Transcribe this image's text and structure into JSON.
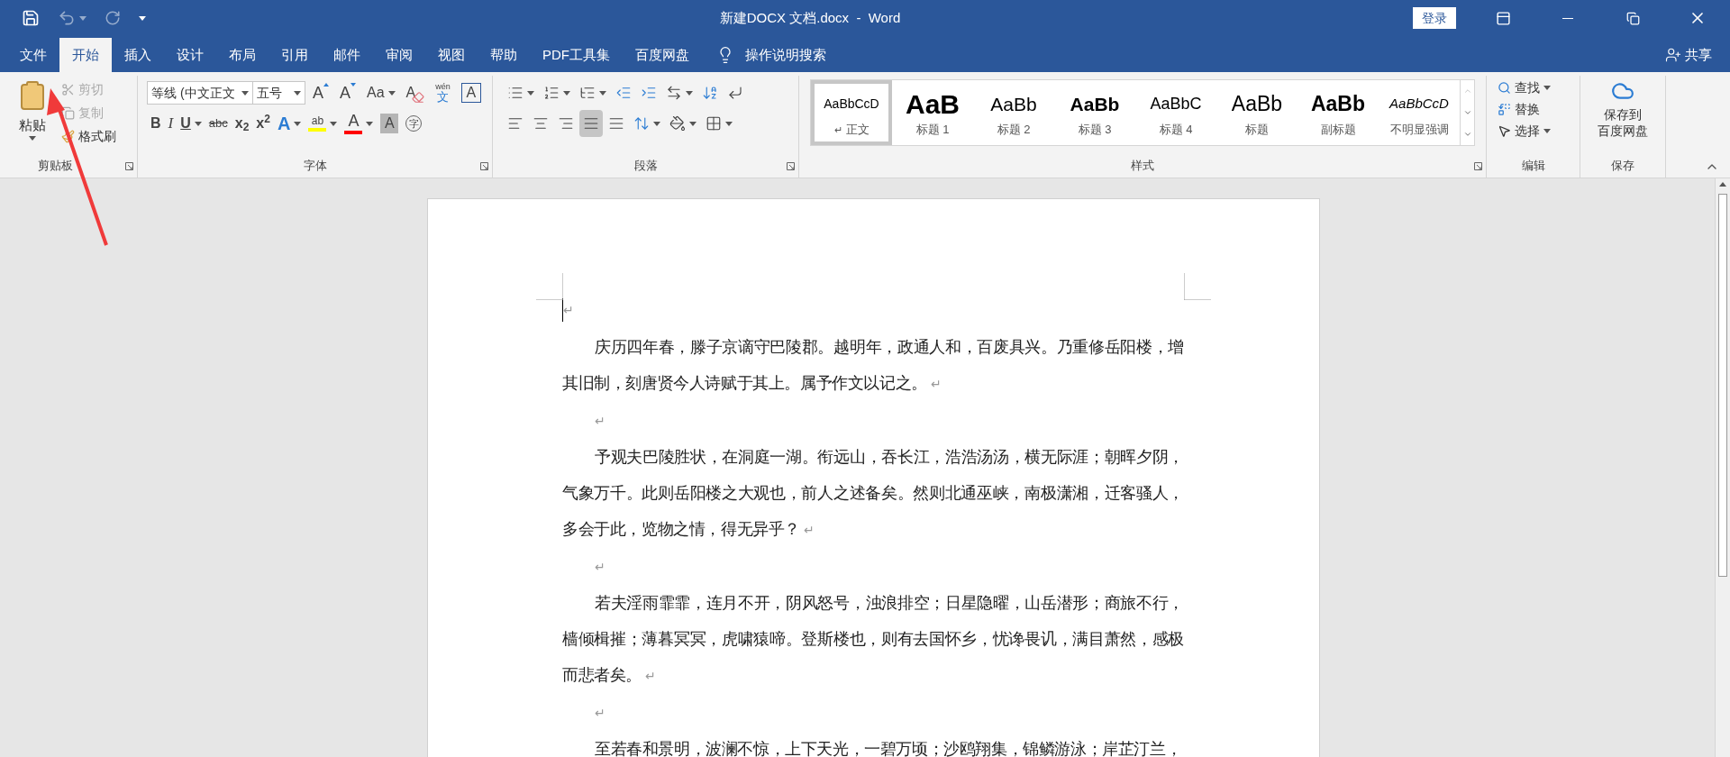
{
  "title_bar": {
    "title": "新建DOCX 文档.docx  -  Word",
    "login": "登录"
  },
  "tabs": [
    {
      "label": "文件",
      "selected": false
    },
    {
      "label": "开始",
      "selected": true
    },
    {
      "label": "插入",
      "selected": false
    },
    {
      "label": "设计",
      "selected": false
    },
    {
      "label": "布局",
      "selected": false
    },
    {
      "label": "引用",
      "selected": false
    },
    {
      "label": "邮件",
      "selected": false
    },
    {
      "label": "审阅",
      "selected": false
    },
    {
      "label": "视图",
      "selected": false
    },
    {
      "label": "帮助",
      "selected": false
    },
    {
      "label": "PDF工具集",
      "selected": false
    },
    {
      "label": "百度网盘",
      "selected": false
    }
  ],
  "tell_me": "操作说明搜索",
  "share": "共享",
  "clipboard": {
    "group": "剪贴板",
    "launcher": true,
    "paste": "粘贴",
    "cut": {
      "label": "剪切",
      "disabled": true
    },
    "copy": {
      "label": "复制",
      "disabled": true
    },
    "painter": {
      "label": "格式刷",
      "disabled": false
    }
  },
  "font": {
    "group": "字体",
    "launcher": true,
    "name": "等线 (中文正文",
    "size": "五号",
    "row1": [
      {
        "kind": "grow",
        "label": "A"
      },
      {
        "kind": "shrink",
        "label": "A"
      },
      {
        "kind": "case",
        "label": "Aa",
        "dropdown": true
      },
      {
        "kind": "clear",
        "label": "A"
      },
      {
        "kind": "phonetic",
        "label": "wén",
        "sub": "文"
      },
      {
        "kind": "border",
        "label": "A"
      }
    ],
    "row2": [
      {
        "kind": "bold",
        "label": "B"
      },
      {
        "kind": "italic",
        "label": "I"
      },
      {
        "kind": "underline",
        "label": "U",
        "dropdown": true
      },
      {
        "kind": "strike",
        "label": "abc"
      },
      {
        "kind": "script",
        "label": "x$_{2}$"
      },
      {
        "kind": "script",
        "label": "x$^{2}$"
      },
      {
        "kind": "effect",
        "label": "A",
        "dropdown": true
      },
      {
        "kind": "highlight",
        "label": "ab",
        "color": "#ffff00",
        "dropdown": true
      },
      {
        "kind": "fontcolor",
        "label": "A",
        "color": "#ff0000",
        "dropdown": true
      },
      {
        "kind": "shading",
        "label": "A"
      },
      {
        "kind": "enclose",
        "label": "字"
      }
    ]
  },
  "paragraph": {
    "group": "段落",
    "launcher": true,
    "row1": [
      {
        "kind": "bullets",
        "dropdown": true
      },
      {
        "kind": "numbering",
        "dropdown": true
      },
      {
        "kind": "multilevel",
        "dropdown": true
      },
      {
        "kind": "outdent"
      },
      {
        "kind": "indent"
      },
      {
        "kind": "layout",
        "dropdown": true
      },
      {
        "kind": "sort"
      },
      {
        "kind": "marks"
      }
    ],
    "alignment": [
      {
        "kind": "left",
        "selected": false
      },
      {
        "kind": "center",
        "selected": false
      },
      {
        "kind": "right",
        "selected": false
      },
      {
        "kind": "justify",
        "selected": true
      },
      {
        "kind": "distributed",
        "selected": false
      }
    ],
    "row2": [
      {
        "kind": "spacing",
        "dropdown": true
      },
      {
        "kind": "fill",
        "dropdown": true
      },
      {
        "kind": "borders",
        "dropdown": true
      }
    ]
  },
  "styles": {
    "group": "样式",
    "launcher": true,
    "items": [
      {
        "kind": "normal",
        "preview": "AaBbCcD",
        "name": "正文",
        "mark": "↵",
        "selected": true
      },
      {
        "kind": "h1",
        "preview": "AaB",
        "name": "标题 1",
        "selected": false
      },
      {
        "kind": "h2",
        "preview": "AaBb",
        "name": "标题 2",
        "selected": false
      },
      {
        "kind": "h3",
        "preview": "AaBb",
        "name": "标题 3",
        "selected": false
      },
      {
        "kind": "h4",
        "preview": "AaBbC",
        "name": "标题 4",
        "selected": false
      },
      {
        "kind": "title",
        "preview": "AaBb",
        "name": "标题",
        "selected": false
      },
      {
        "kind": "subtitle",
        "preview": "AaBb",
        "name": "副标题",
        "selected": false
      },
      {
        "kind": "emphasis",
        "preview": "AaBbCcD",
        "name": "不明显强调",
        "selected": false
      }
    ]
  },
  "editing": {
    "group": "编辑",
    "find": "查找",
    "replace": "替换",
    "select": "选择"
  },
  "save": {
    "group": "保存",
    "button": [
      "保存到",
      "百度网盘"
    ]
  },
  "document": {
    "paragraphs": [
      {
        "kind": "cursor",
        "mark": "↵"
      },
      {
        "kind": "text",
        "text": "庆历四年春，滕子京谪守巴陵郡。越明年，政通人和，百废具兴。乃重修岳阳楼，增其旧制，刻唐贤今人诗赋于其上。属予作文以记之。",
        "mark": "↵"
      },
      {
        "kind": "empty",
        "mark": "↵"
      },
      {
        "kind": "text",
        "text": "予观夫巴陵胜状，在洞庭一湖。衔远山，吞长江，浩浩汤汤，横无际涯；朝晖夕阴，气象万千。此则岳阳楼之大观也，前人之述备矣。然则北通巫峡，南极潇湘，迁客骚人，多会于此，览物之情，得无异乎？",
        "mark": "↵"
      },
      {
        "kind": "empty",
        "mark": "↵"
      },
      {
        "kind": "text",
        "text": "若夫淫雨霏霏，连月不开，阴风怒号，浊浪排空；日星隐曜，山岳潜形；商旅不行，樯倾楫摧；薄暮冥冥，虎啸猿啼。登斯楼也，则有去国怀乡，忧谗畏讥，满目萧然，感极而悲者矣。",
        "mark": "↵"
      },
      {
        "kind": "empty",
        "mark": "↵"
      },
      {
        "kind": "text",
        "text": "至若春和景明，波澜不惊，上下天光，一碧万顷；沙鸥翔集，锦鳞游泳；岸芷汀兰，"
      }
    ]
  }
}
